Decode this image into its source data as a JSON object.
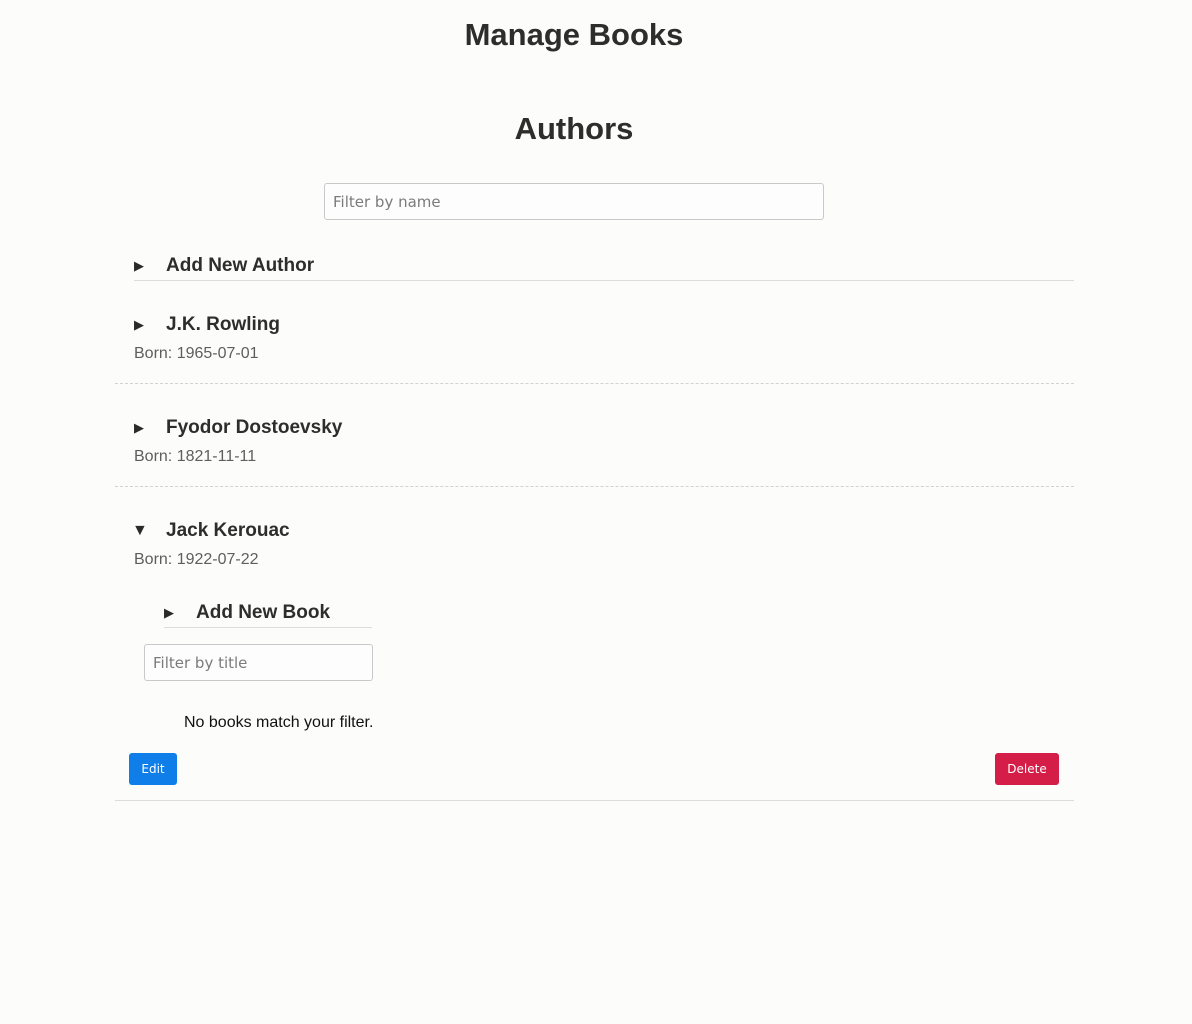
{
  "page": {
    "title": "Manage Books"
  },
  "authors_section": {
    "title": "Authors",
    "filter_placeholder": "Filter by name",
    "add_author_label": "Add New Author",
    "authors": [
      {
        "name": "J.K. Rowling",
        "born": "Born: 1965-07-01",
        "expanded": false
      },
      {
        "name": "Fyodor Dostoevsky",
        "born": "Born: 1821-11-11",
        "expanded": false
      },
      {
        "name": "Jack Kerouac",
        "born": "Born: 1922-07-22",
        "expanded": true
      }
    ]
  },
  "expanded_author": {
    "add_book_label": "Add New Book",
    "book_filter_placeholder": "Filter by title",
    "empty_message": "No books match your filter.",
    "edit_label": "Edit",
    "delete_label": "Delete"
  },
  "icons": {
    "collapsed": "▶",
    "expanded": "▼"
  },
  "colors": {
    "edit_button": "#0f7ee8",
    "delete_button": "#d41e47"
  }
}
